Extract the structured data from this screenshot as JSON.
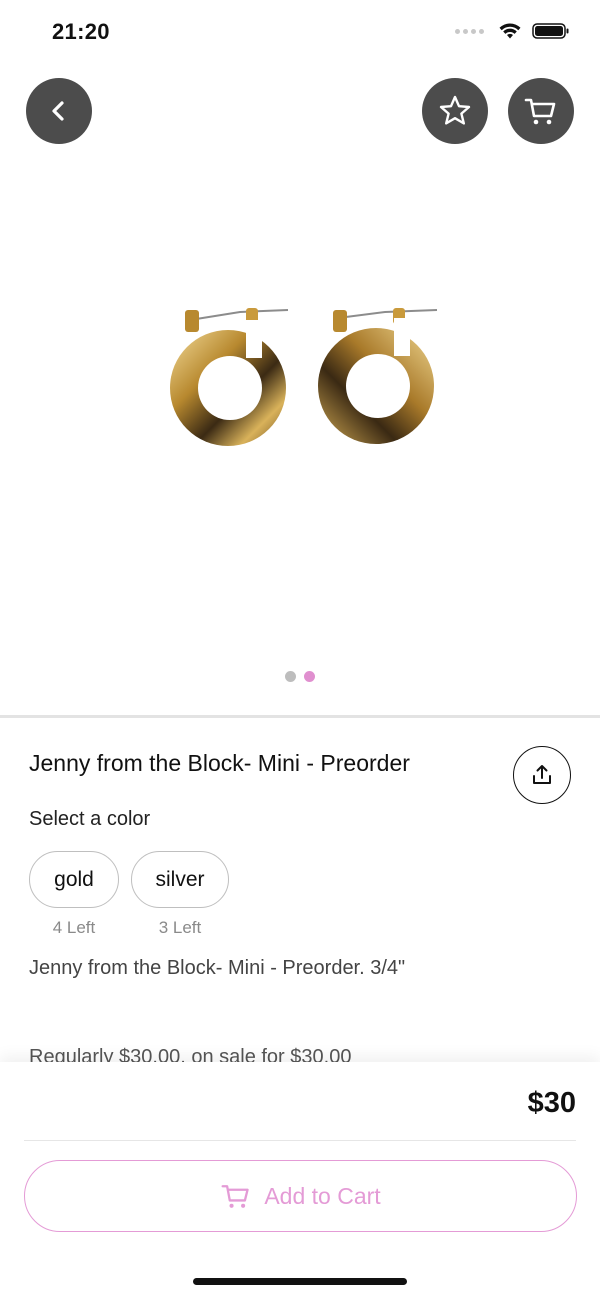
{
  "status_bar": {
    "time": "21:20"
  },
  "header": {
    "back_icon": "chevron-left-icon",
    "favorite_icon": "star-icon",
    "cart_icon": "cart-icon"
  },
  "gallery": {
    "image_count": 2,
    "active_index": 1
  },
  "product": {
    "title": "Jenny from the Block- Mini - Preorder",
    "color_label": "Select a color",
    "colors": [
      {
        "name": "gold",
        "stock": "4 Left"
      },
      {
        "name": "silver",
        "stock": "3 Left"
      }
    ],
    "description": "Jenny from the Block- Mini - Preorder. 3/4\"",
    "sale_text": "Regularly $30.00, on sale for $30.00"
  },
  "footer": {
    "price": "$30",
    "add_to_cart_label": "Add to Cart"
  },
  "colors": {
    "accent_pink": "#e49bd6",
    "button_dark": "#4c4c4c"
  }
}
